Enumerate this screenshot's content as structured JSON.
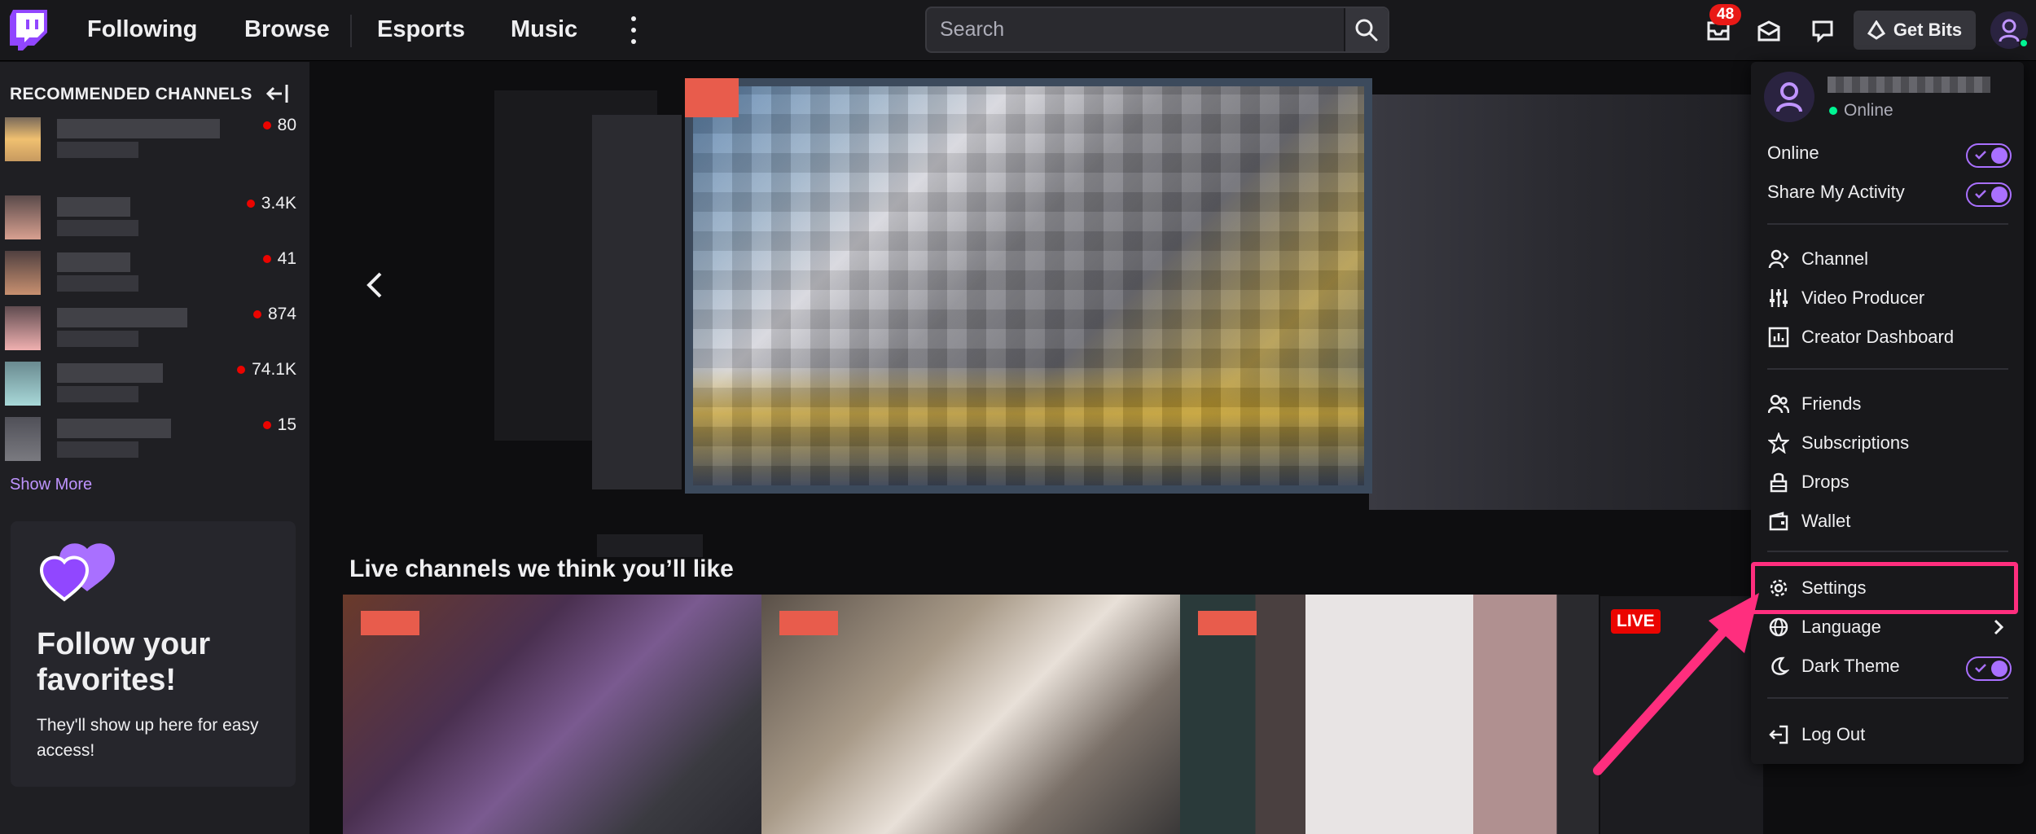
{
  "nav": {
    "links": [
      "Following",
      "Browse",
      "Esports",
      "Music"
    ],
    "search_placeholder": "Search",
    "notification_count": "48",
    "get_bits_label": "Get Bits"
  },
  "sidebar": {
    "heading": "RECOMMENDED CHANNELS",
    "channels": [
      {
        "viewers": "80"
      },
      {
        "viewers": "3.4K"
      },
      {
        "viewers": "41"
      },
      {
        "viewers": "874"
      },
      {
        "viewers": "74.1K"
      },
      {
        "viewers": "15"
      }
    ],
    "show_more": "Show More",
    "follow_card": {
      "title": "Follow your favorites!",
      "subtitle": "They'll show up here for easy access!"
    }
  },
  "main": {
    "section_title": "Live channels we think you’ll like",
    "live_badge": "LIVE"
  },
  "menu": {
    "status": "Online",
    "toggles": [
      {
        "label": "Online",
        "on": true
      },
      {
        "label": "Share My Activity",
        "on": true
      }
    ],
    "group1": [
      "Channel",
      "Video Producer",
      "Creator Dashboard"
    ],
    "group2": [
      "Friends",
      "Subscriptions",
      "Drops",
      "Wallet"
    ],
    "group3": {
      "settings": "Settings",
      "language": "Language",
      "dark_theme": "Dark Theme"
    },
    "logout": "Log Out"
  },
  "colors": {
    "accent": "#a970ff",
    "live": "#eb0400",
    "highlight": "#ff2e7e",
    "online": "#00f593"
  }
}
